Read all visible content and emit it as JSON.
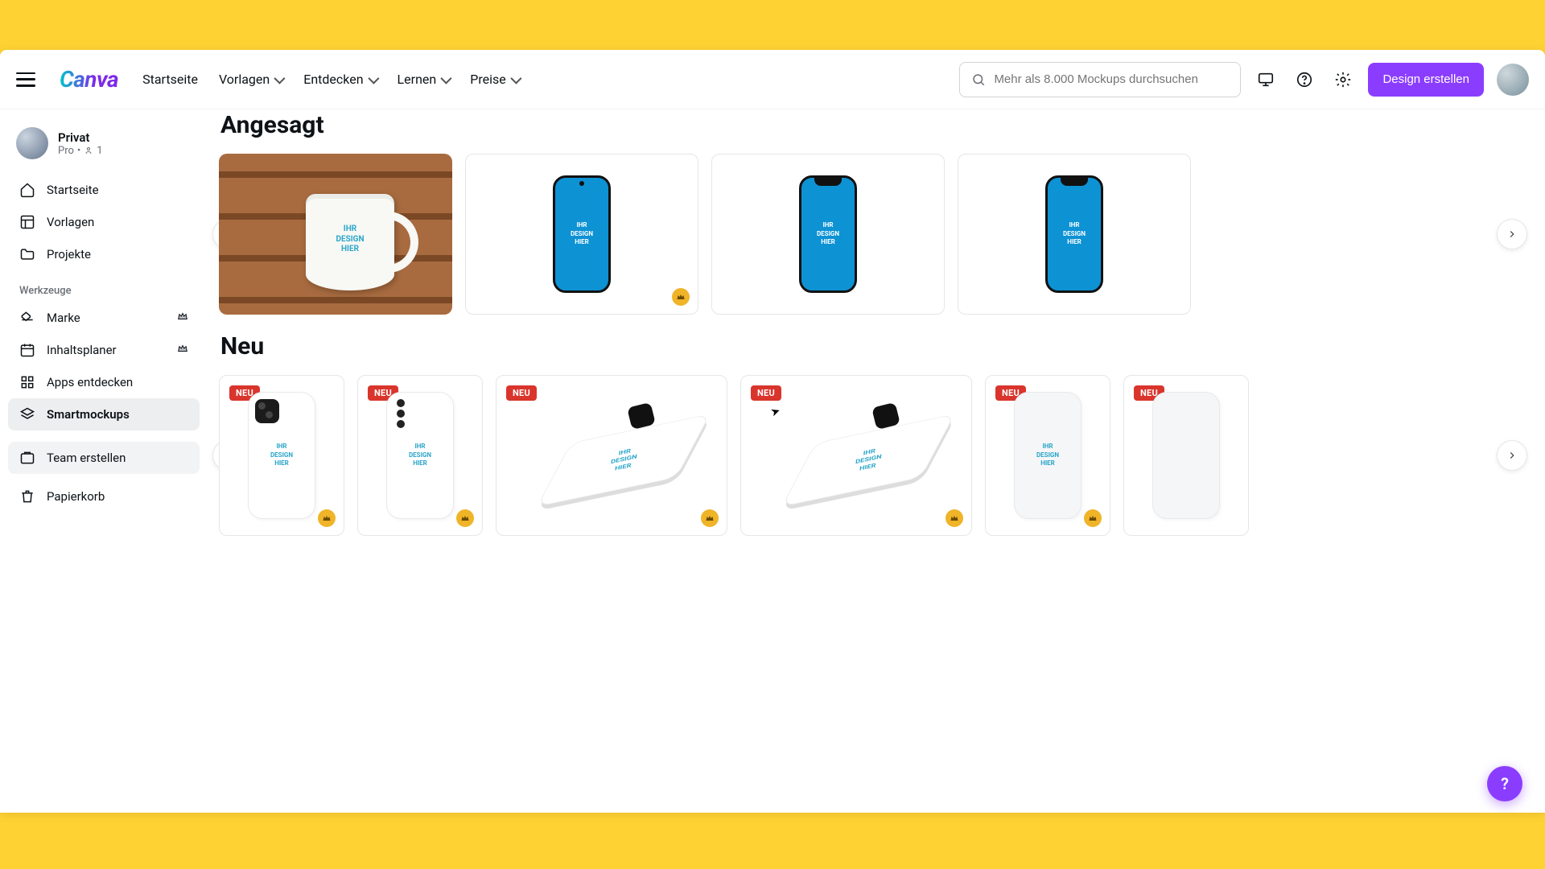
{
  "banner_bg": "#FFD233",
  "accent": "#8b3dff",
  "header": {
    "logo_text": "Canva",
    "nav": {
      "home": "Startseite",
      "templates": "Vorlagen",
      "explore": "Entdecken",
      "learn": "Lernen",
      "pricing": "Preise"
    },
    "search_placeholder": "Mehr als 8.000 Mockups durchsuchen",
    "cta": "Design erstellen"
  },
  "sidebar": {
    "team_name": "Privat",
    "team_plan": "Pro",
    "team_members": "1",
    "items": {
      "home": "Startseite",
      "templates": "Vorlagen",
      "projects": "Projekte"
    },
    "tools_label": "Werkzeuge",
    "tools": {
      "brand": "Marke",
      "planner": "Inhaltsplaner",
      "apps": "Apps entdecken",
      "smartmockups": "Smartmockups"
    },
    "create_team": "Team erstellen",
    "trash": "Papierkorb"
  },
  "sections": {
    "trending": "Angesagt",
    "new": "Neu"
  },
  "mockup_placeholder": "IHR\nDESIGN\nHIER",
  "badge_new": "NEU",
  "help": "?"
}
